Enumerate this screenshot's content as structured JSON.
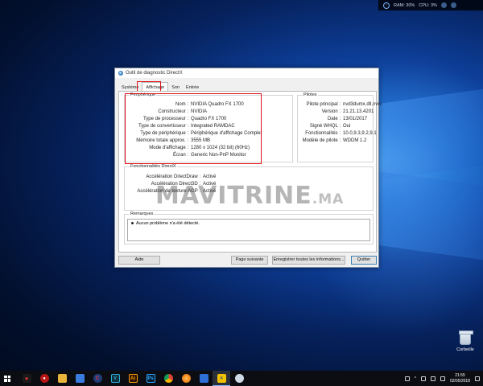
{
  "gadget": {
    "ram": "RAM: 30%",
    "cpu": "CPU: 3%"
  },
  "desktop": {
    "recycle_label": "Corbeille"
  },
  "watermark": {
    "main": "MAVITRINE",
    "suffix": ".MA"
  },
  "window": {
    "title": "Outil de diagnostic DirectX",
    "tabs": [
      "Système",
      "Affichage",
      "Son",
      "Entrée"
    ],
    "active_tab": "Affichage",
    "device": {
      "title": "Périphérique",
      "rows": [
        {
          "k": "Nom :",
          "v": "NVIDIA Quadro FX 1700"
        },
        {
          "k": "Constructeur :",
          "v": "NVIDIA"
        },
        {
          "k": "Type de processeur :",
          "v": "Quadro FX 1700"
        },
        {
          "k": "Type de convertisseur :",
          "v": "Integrated RAMDAC"
        },
        {
          "k": "Type de périphérique :",
          "v": "Périphérique d'affichage Complet"
        },
        {
          "k": "Mémoire totale approx. :",
          "v": "3555 MB"
        },
        {
          "k": "Mode d'affichage :",
          "v": "1280 x 1024 (32 bit) (60Hz)"
        },
        {
          "k": "Écran :",
          "v": "Generic Non-PnP Monitor"
        }
      ]
    },
    "drivers": {
      "title": "Pilotes",
      "rows": [
        {
          "k": "Pilote principal :",
          "v": "nvd3dumx.dll,nvw"
        },
        {
          "k": "Version :",
          "v": "21.21.13.4201"
        },
        {
          "k": "Date :",
          "v": "13/01/2017"
        },
        {
          "k": "Signé WHQL :",
          "v": "Oui"
        },
        {
          "k": "Fonctionnalités :",
          "v": "10.0,9.3,9.2,9.1"
        },
        {
          "k": "Modèle de pilote :",
          "v": "WDDM 1.2"
        }
      ]
    },
    "features": {
      "title": "Fonctionnalités DirectX",
      "rows": [
        {
          "k": "Accélération DirectDraw :",
          "v": "Activé"
        },
        {
          "k": "Accélération Direct3D :",
          "v": "Activé"
        },
        {
          "k": "Accélération de texture AGP :",
          "v": "Activé"
        }
      ]
    },
    "notes": {
      "title": "Remarques",
      "text": "Aucun problème n'a été détecté."
    },
    "buttons": {
      "help": "Aide",
      "next_page": "Page suivante",
      "save_all": "Enregistrer toutes les informations...",
      "quit": "Quitter"
    }
  },
  "taskbar": {
    "time": "21:55",
    "date": "02/05/2018"
  }
}
